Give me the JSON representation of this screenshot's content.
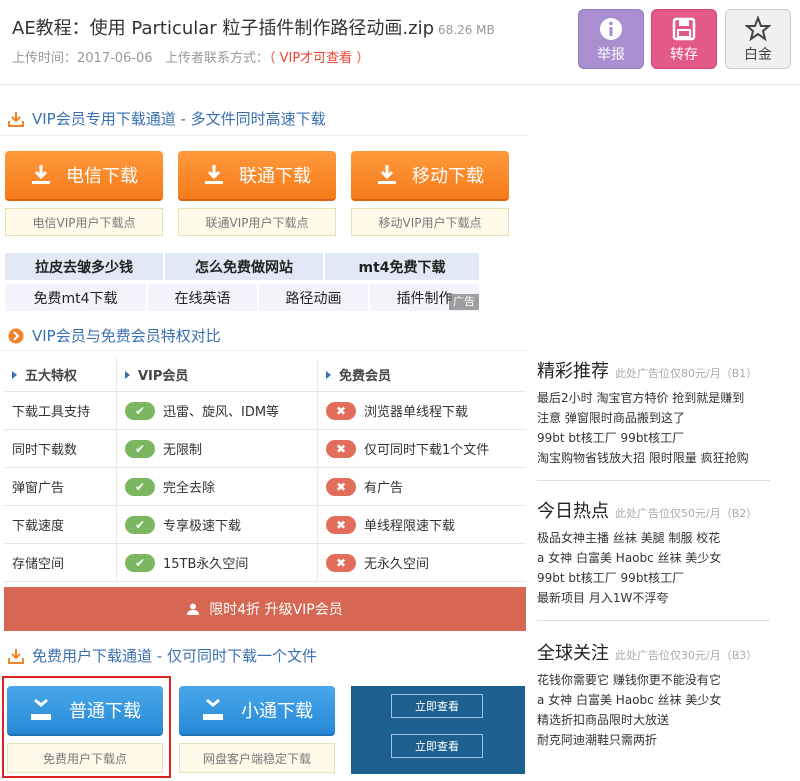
{
  "header": {
    "title": "AE教程：使用 Particular 粒子插件制作路径动画.zip",
    "size": "68.26 MB",
    "upload_label": "上传时间：2017-06-06",
    "contact_label": "上传者联系方式：",
    "contact_value": "（ VIP才可查看 ）",
    "buttons": {
      "report": "举报",
      "save": "转存",
      "gold": "白金"
    }
  },
  "vip_section": {
    "title": "VIP会员专用下载通道 - 多文件同时高速下载",
    "downloads": [
      {
        "label": "电信下载",
        "note": "电信VIP用户下载点"
      },
      {
        "label": "联通下载",
        "note": "联通VIP用户下载点"
      },
      {
        "label": "移动下载",
        "note": "移动VIP用户下载点"
      }
    ]
  },
  "tags": {
    "row1": [
      "拉皮去皱多少钱",
      "怎么免费做网站",
      "mt4免费下载"
    ],
    "row2": [
      "免费mt4下载",
      "在线英语",
      "路径动画",
      "插件制作"
    ],
    "ad_label": "广告"
  },
  "compare": {
    "title": "VIP会员与免费会员特权对比",
    "headers": [
      "五大特权",
      "VIP会员",
      "免费会员"
    ],
    "rows": [
      {
        "feature": "下载工具支持",
        "vip": "迅雷、旋风、IDM等",
        "free": "浏览器单线程下载"
      },
      {
        "feature": "同时下载数",
        "vip": "无限制",
        "free": "仅可同时下载1个文件"
      },
      {
        "feature": "弹窗广告",
        "vip": "完全去除",
        "free": "有广告"
      },
      {
        "feature": "下载速度",
        "vip": "专享极速下载",
        "free": "单线程限速下载"
      },
      {
        "feature": "存储空间",
        "vip": "15TB永久空间",
        "free": "无永久空间"
      }
    ],
    "upgrade": "限时4折 升级VIP会员"
  },
  "free_section": {
    "title": "免费用户下载通道 - 仅可同时下载一个文件",
    "downloads": [
      {
        "label": "普通下载",
        "note": "免费用户下载点"
      },
      {
        "label": "小通下载",
        "note": "网盘客户端稳定下载"
      }
    ],
    "ad_buttons": [
      "立即查看",
      "立即查看"
    ]
  },
  "sidebar": [
    {
      "title": "精彩推荐",
      "note": "此处广告位仅80元/月（B1）",
      "lines": [
        "最后2小时 淘宝官方特价 抢到就是赚到",
        "注意 弹窗限时商品搬到这了",
        "99bt bt核工厂 99bt核工厂",
        "淘宝购物省钱放大招 限时限量 疯狂抢购"
      ]
    },
    {
      "title": "今日热点",
      "note": "此处广告位仅50元/月（B2）",
      "lines": [
        "极品女神主播 丝袜 美腿 制服 校花",
        "a 女神 白富美 Haobc 丝袜 美少女",
        "99bt bt核工厂 99bt核工厂",
        "最新项目 月入1W不浮夸"
      ]
    },
    {
      "title": "全球关注",
      "note": "此处广告位仅30元/月（B3）",
      "lines": [
        "花钱你需要它 赚钱你更不能没有它",
        "a 女神 白富美 Haobc 丝袜 美少女",
        "精选折扣商品限时大放送",
        "耐克阿迪潮鞋只需两折"
      ]
    }
  ],
  "colors": {
    "orange": "#f57a1a",
    "blue": "#2688d6",
    "vip_red": "#e43",
    "upgrade": "#d66753"
  }
}
